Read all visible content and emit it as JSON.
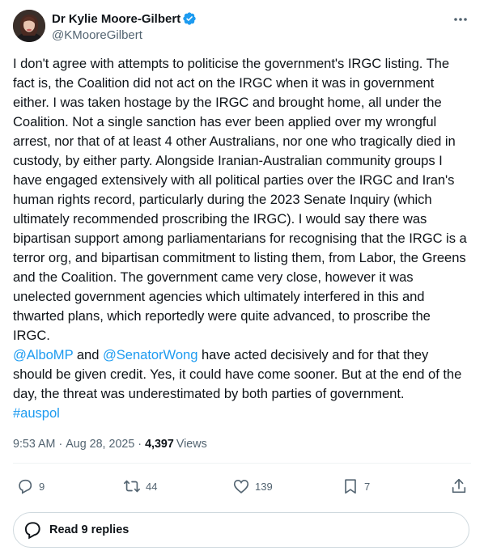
{
  "author": {
    "display_name": "Dr Kylie Moore-Gilbert",
    "handle": "@KMooreGilbert",
    "verified": true
  },
  "tweet": {
    "paragraph1": "I don't agree with attempts to politicise the government's IRGC listing. The fact is, the Coalition did not act on the IRGC when it was in government either. I was taken hostage by the IRGC and brought home, all under the Coalition. Not a single sanction has ever been applied over my wrongful arrest, nor that of at least 4 other Australians, nor one who tragically died in custody, by either party. Alongside Iranian-Australian community groups I have engaged extensively with all political parties over the IRGC and Iran's human rights record, particularly during the 2023 Senate Inquiry (which ultimately recommended proscribing the IRGC). I would say there was bipartisan support among parliamentarians for recognising that the IRGC is a terror org, and bipartisan commitment to listing them, from Labor, the Greens and the Coalition. The government came very close, however it was unelected government agencies which ultimately interfered in this and thwarted plans, which reportedly were quite advanced, to proscribe the IRGC.",
    "mention1": "@AlboMP",
    "and_text": " and ",
    "mention2": "@SenatorWong",
    "paragraph2_rest": " have acted decisively and for that they should be given credit. Yes, it could have come sooner. But at the end of the day, the threat was underestimated by both parties of government.",
    "hashtag": "#auspol"
  },
  "meta": {
    "time": "9:53 AM",
    "separator": "·",
    "date": "Aug 28, 2025",
    "views_count": "4,397",
    "views_label": "Views"
  },
  "actions": {
    "replies": "9",
    "retweets": "44",
    "likes": "139",
    "bookmarks": "7"
  },
  "read_replies_label": "Read 9 replies",
  "colors": {
    "accent": "#1d9bf0",
    "text": "#0f1419",
    "muted": "#536471",
    "border": "#cfd9de"
  }
}
